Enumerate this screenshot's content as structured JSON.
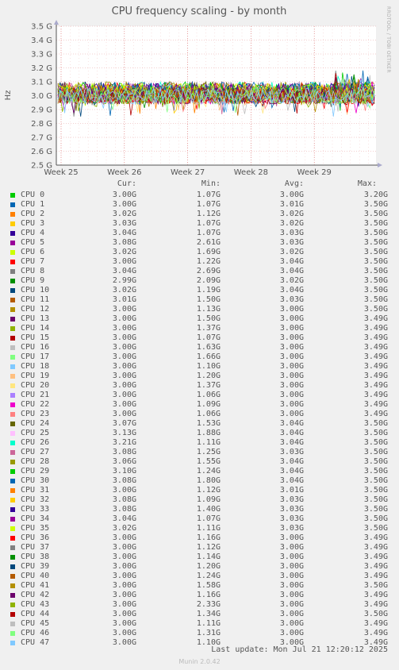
{
  "side_label": "RRDTOOL / TOBI OETIKER",
  "footer": {
    "last_update": "Last update: Mon Jul 21 12:20:12 2025",
    "version": "Munin 2.0.42"
  },
  "legend_header": {
    "cur": "Cur:",
    "min": "Min:",
    "avg": "Avg:",
    "max": "Max:"
  },
  "chart_data": {
    "type": "line",
    "title": "CPU frequency scaling - by month",
    "ylabel": "Hz",
    "xlabel": "",
    "ylim": [
      2.5,
      3.5
    ],
    "y_ticks": [
      "2.5 G",
      "2.6 G",
      "2.7 G",
      "2.8 G",
      "2.9 G",
      "3.0 G",
      "3.1 G",
      "3.2 G",
      "3.3 G",
      "3.4 G",
      "3.5 G"
    ],
    "x_ticks": [
      "Week 25",
      "Week 26",
      "Week 27",
      "Week 28",
      "Week 29"
    ],
    "grid": true,
    "note": "48 series of noisy per-CPU frequency around 3.0 GHz, mostly between 2.95 G and 3.12 G, occasional dips to ~2.86 G and peaks to ~3.2 G",
    "series": [
      {
        "name": "CPU 0",
        "color": "#00cc00",
        "cur": "3.00G",
        "min": "1.07G",
        "avg": "3.00G",
        "max": "3.20G"
      },
      {
        "name": "CPU 1",
        "color": "#0066b3",
        "cur": "3.00G",
        "min": "1.07G",
        "avg": "3.01G",
        "max": "3.50G"
      },
      {
        "name": "CPU 2",
        "color": "#ff8000",
        "cur": "3.02G",
        "min": "1.12G",
        "avg": "3.02G",
        "max": "3.50G"
      },
      {
        "name": "CPU 3",
        "color": "#ffcc00",
        "cur": "3.03G",
        "min": "1.07G",
        "avg": "3.02G",
        "max": "3.50G"
      },
      {
        "name": "CPU 4",
        "color": "#330099",
        "cur": "3.04G",
        "min": "1.07G",
        "avg": "3.03G",
        "max": "3.50G"
      },
      {
        "name": "CPU 5",
        "color": "#990099",
        "cur": "3.08G",
        "min": "2.61G",
        "avg": "3.03G",
        "max": "3.50G"
      },
      {
        "name": "CPU 6",
        "color": "#ccff00",
        "cur": "3.02G",
        "min": "1.69G",
        "avg": "3.02G",
        "max": "3.50G"
      },
      {
        "name": "CPU 7",
        "color": "#ff0000",
        "cur": "3.00G",
        "min": "1.22G",
        "avg": "3.04G",
        "max": "3.50G"
      },
      {
        "name": "CPU 8",
        "color": "#808080",
        "cur": "3.04G",
        "min": "2.69G",
        "avg": "3.04G",
        "max": "3.50G"
      },
      {
        "name": "CPU 9",
        "color": "#008f00",
        "cur": "2.99G",
        "min": "2.09G",
        "avg": "3.02G",
        "max": "3.50G"
      },
      {
        "name": "CPU 10",
        "color": "#00487d",
        "cur": "3.02G",
        "min": "1.19G",
        "avg": "3.04G",
        "max": "3.50G"
      },
      {
        "name": "CPU 11",
        "color": "#b35a00",
        "cur": "3.01G",
        "min": "1.50G",
        "avg": "3.03G",
        "max": "3.50G"
      },
      {
        "name": "CPU 12",
        "color": "#b38f00",
        "cur": "3.00G",
        "min": "1.13G",
        "avg": "3.00G",
        "max": "3.50G"
      },
      {
        "name": "CPU 13",
        "color": "#6b006b",
        "cur": "3.00G",
        "min": "1.50G",
        "avg": "3.00G",
        "max": "3.49G"
      },
      {
        "name": "CPU 14",
        "color": "#8fb300",
        "cur": "3.00G",
        "min": "1.37G",
        "avg": "3.00G",
        "max": "3.49G"
      },
      {
        "name": "CPU 15",
        "color": "#b30000",
        "cur": "3.00G",
        "min": "1.07G",
        "avg": "3.00G",
        "max": "3.49G"
      },
      {
        "name": "CPU 16",
        "color": "#bebebe",
        "cur": "3.00G",
        "min": "1.63G",
        "avg": "3.00G",
        "max": "3.49G"
      },
      {
        "name": "CPU 17",
        "color": "#80ff80",
        "cur": "3.00G",
        "min": "1.66G",
        "avg": "3.00G",
        "max": "3.49G"
      },
      {
        "name": "CPU 18",
        "color": "#80c9ff",
        "cur": "3.00G",
        "min": "1.10G",
        "avg": "3.00G",
        "max": "3.49G"
      },
      {
        "name": "CPU 19",
        "color": "#ffc080",
        "cur": "3.00G",
        "min": "1.20G",
        "avg": "3.00G",
        "max": "3.49G"
      },
      {
        "name": "CPU 20",
        "color": "#ffe680",
        "cur": "3.00G",
        "min": "1.37G",
        "avg": "3.00G",
        "max": "3.49G"
      },
      {
        "name": "CPU 21",
        "color": "#aa80ff",
        "cur": "3.00G",
        "min": "1.06G",
        "avg": "3.00G",
        "max": "3.49G"
      },
      {
        "name": "CPU 22",
        "color": "#ee00cc",
        "cur": "3.00G",
        "min": "1.09G",
        "avg": "3.00G",
        "max": "3.49G"
      },
      {
        "name": "CPU 23",
        "color": "#ff8080",
        "cur": "3.00G",
        "min": "1.06G",
        "avg": "3.00G",
        "max": "3.49G"
      },
      {
        "name": "CPU 24",
        "color": "#666600",
        "cur": "3.07G",
        "min": "1.53G",
        "avg": "3.04G",
        "max": "3.50G"
      },
      {
        "name": "CPU 25",
        "color": "#ffbfff",
        "cur": "3.13G",
        "min": "1.88G",
        "avg": "3.04G",
        "max": "3.50G"
      },
      {
        "name": "CPU 26",
        "color": "#00ffcc",
        "cur": "3.21G",
        "min": "1.11G",
        "avg": "3.04G",
        "max": "3.50G"
      },
      {
        "name": "CPU 27",
        "color": "#cc6699",
        "cur": "3.08G",
        "min": "1.25G",
        "avg": "3.03G",
        "max": "3.50G"
      },
      {
        "name": "CPU 28",
        "color": "#999900",
        "cur": "3.06G",
        "min": "1.55G",
        "avg": "3.04G",
        "max": "3.50G"
      },
      {
        "name": "CPU 29",
        "color": "#00cc00",
        "cur": "3.10G",
        "min": "1.24G",
        "avg": "3.04G",
        "max": "3.50G"
      },
      {
        "name": "CPU 30",
        "color": "#0066b3",
        "cur": "3.08G",
        "min": "1.80G",
        "avg": "3.04G",
        "max": "3.50G"
      },
      {
        "name": "CPU 31",
        "color": "#ff8000",
        "cur": "3.00G",
        "min": "1.12G",
        "avg": "3.01G",
        "max": "3.50G"
      },
      {
        "name": "CPU 32",
        "color": "#ffcc00",
        "cur": "3.08G",
        "min": "1.09G",
        "avg": "3.03G",
        "max": "3.50G"
      },
      {
        "name": "CPU 33",
        "color": "#330099",
        "cur": "3.08G",
        "min": "1.40G",
        "avg": "3.03G",
        "max": "3.50G"
      },
      {
        "name": "CPU 34",
        "color": "#990099",
        "cur": "3.04G",
        "min": "1.07G",
        "avg": "3.03G",
        "max": "3.50G"
      },
      {
        "name": "CPU 35",
        "color": "#ccff00",
        "cur": "3.02G",
        "min": "1.11G",
        "avg": "3.03G",
        "max": "3.50G"
      },
      {
        "name": "CPU 36",
        "color": "#ff0000",
        "cur": "3.00G",
        "min": "1.16G",
        "avg": "3.00G",
        "max": "3.49G"
      },
      {
        "name": "CPU 37",
        "color": "#808080",
        "cur": "3.00G",
        "min": "1.12G",
        "avg": "3.00G",
        "max": "3.49G"
      },
      {
        "name": "CPU 38",
        "color": "#008f00",
        "cur": "3.00G",
        "min": "1.14G",
        "avg": "3.00G",
        "max": "3.49G"
      },
      {
        "name": "CPU 39",
        "color": "#00487d",
        "cur": "3.00G",
        "min": "1.20G",
        "avg": "3.00G",
        "max": "3.49G"
      },
      {
        "name": "CPU 40",
        "color": "#b35a00",
        "cur": "3.00G",
        "min": "1.24G",
        "avg": "3.00G",
        "max": "3.49G"
      },
      {
        "name": "CPU 41",
        "color": "#b38f00",
        "cur": "3.00G",
        "min": "1.58G",
        "avg": "3.00G",
        "max": "3.50G"
      },
      {
        "name": "CPU 42",
        "color": "#6b006b",
        "cur": "3.00G",
        "min": "1.16G",
        "avg": "3.00G",
        "max": "3.49G"
      },
      {
        "name": "CPU 43",
        "color": "#8fb300",
        "cur": "3.00G",
        "min": "2.33G",
        "avg": "3.00G",
        "max": "3.49G"
      },
      {
        "name": "CPU 44",
        "color": "#b30000",
        "cur": "3.00G",
        "min": "1.34G",
        "avg": "3.00G",
        "max": "3.50G"
      },
      {
        "name": "CPU 45",
        "color": "#bebebe",
        "cur": "3.00G",
        "min": "1.11G",
        "avg": "3.00G",
        "max": "3.49G"
      },
      {
        "name": "CPU 46",
        "color": "#80ff80",
        "cur": "3.00G",
        "min": "1.31G",
        "avg": "3.00G",
        "max": "3.49G"
      },
      {
        "name": "CPU 47",
        "color": "#80c9ff",
        "cur": "3.00G",
        "min": "1.10G",
        "avg": "3.00G",
        "max": "3.49G"
      }
    ]
  }
}
